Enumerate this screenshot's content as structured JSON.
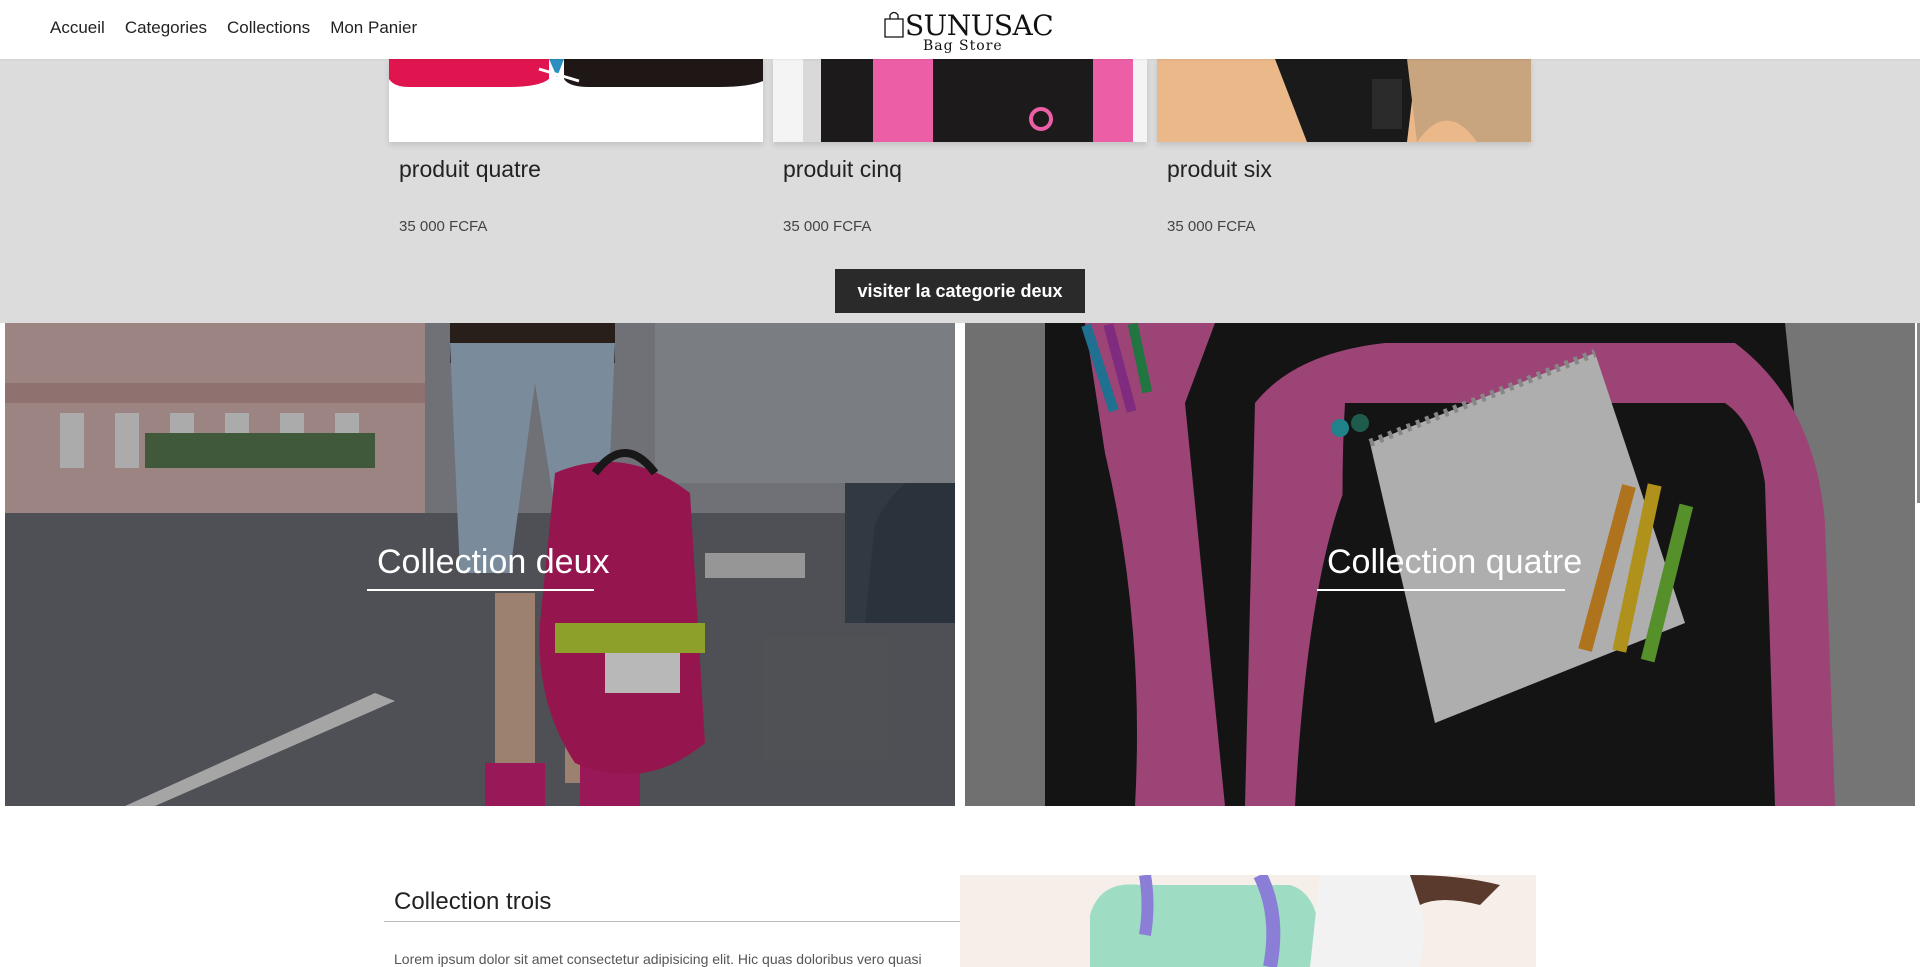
{
  "nav": {
    "items": [
      "Accueil",
      "Categories",
      "Collections",
      "Mon Panier"
    ]
  },
  "brand": {
    "name": "SUNUSAC",
    "subtitle": "Bag Store"
  },
  "products": [
    {
      "title": "produit quatre",
      "price": "35 000 FCFA"
    },
    {
      "title": "produit cinq",
      "price": "35 000 FCFA"
    },
    {
      "title": "produit six",
      "price": "35 000 FCFA"
    }
  ],
  "category_button": "visiter la categorie deux",
  "collections": [
    {
      "title": "Collection deux"
    },
    {
      "title": "Collection quatre"
    }
  ],
  "collection_trois": {
    "title": "Collection trois",
    "text": "Lorem ipsum dolor sit amet consectetur adipisicing elit. Hic quas doloribus vero quasi"
  },
  "colors": {
    "band": "#dcdcdc",
    "button": "#2a2a2a",
    "accent_pink": "#e0247a"
  },
  "icons": [
    "shopping-bag-icon"
  ]
}
